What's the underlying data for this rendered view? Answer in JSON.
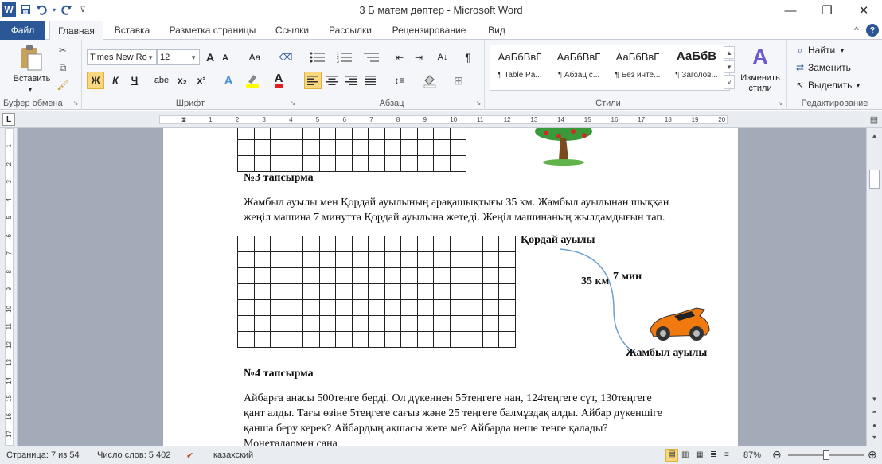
{
  "window": {
    "title": "3 Б матем дәптер  -  Microsoft Word"
  },
  "qat": {
    "word_icon": "W",
    "save_icon": "save-icon",
    "undo_icon": "undo-icon",
    "redo_icon": "redo-icon"
  },
  "tabs": {
    "file": "Файл",
    "items": [
      "Главная",
      "Вставка",
      "Разметка страницы",
      "Ссылки",
      "Рассылки",
      "Рецензирование",
      "Вид"
    ]
  },
  "ribbon": {
    "clipboard": {
      "paste": "Вставить",
      "label": "Буфер обмена"
    },
    "font": {
      "name": "Times New Ro",
      "size": "12",
      "label": "Шрифт",
      "bold": "Ж",
      "italic": "К",
      "underline": "Ч",
      "strike": "abe",
      "sub": "x₂",
      "sup": "x²",
      "grow": "A",
      "shrink": "A",
      "case": "Aa",
      "color": "A"
    },
    "paragraph": {
      "label": "Абзац"
    },
    "styles": {
      "label": "Стили",
      "items": [
        {
          "preview": "АаБбВвГ",
          "name": "¶ Table Pa..."
        },
        {
          "preview": "АаБбВвГ",
          "name": "¶ Абзац с..."
        },
        {
          "preview": "АаБбВвГ",
          "name": "¶ Без инте..."
        },
        {
          "preview": "АаБбВ",
          "name": "¶ Заголов..."
        }
      ],
      "change": "Изменить стили"
    },
    "editing": {
      "label": "Редактирование",
      "find": "Найти",
      "replace": "Заменить",
      "select": "Выделить"
    }
  },
  "ruler": {
    "numbers": [
      "1",
      "2",
      "3",
      "4",
      "5",
      "6",
      "7",
      "8",
      "9",
      "10",
      "11",
      "12",
      "13",
      "14",
      "15",
      "16",
      "17",
      "18",
      "19",
      "20"
    ]
  },
  "vruler": {
    "numbers": [
      "1",
      "2",
      "3",
      "4",
      "5",
      "6",
      "7",
      "8",
      "9",
      "10",
      "11",
      "12",
      "13",
      "14",
      "15",
      "16",
      "17"
    ]
  },
  "document": {
    "task3_heading": "№3 тапсырма",
    "task3_text_line1": "Жамбыл ауылы мен Қордай ауылының арақашықтығы 35 км. Жамбыл ауылынан шыққан",
    "task3_text_line2": "жеңіл машина 7 минутта Қордай ауылына жетеді. Жеңіл машинаның жылдамдығын тап.",
    "diagram": {
      "top_label": "Қордай ауылы",
      "distance": "35 км",
      "time": "7 мин",
      "bottom_label": "Жамбыл ауылы"
    },
    "task4_heading": "№4 тапсырма",
    "task4_line1": "Айбарға анасы 500теңге берді. Ол дүкеннен 55теңгеге нан, 124теңгеге сүт, 130теңгеге",
    "task4_line2": "қант алды. Тағы өзіне 5теңгеге сағыз және 25 теңгеге балмұздақ алды. Айбар дүкеншіге",
    "task4_line3": "қанша беру керек? Айбардың ақшасы жете ме? Айбарда неше теңге қалады?",
    "task4_line4": "Монеталармен сана"
  },
  "status": {
    "page": "Страница: 7 из 54",
    "words": "Число слов: 5 402",
    "lang": "казахский",
    "zoom": "87%",
    "zoom_fraction": 0.5
  }
}
